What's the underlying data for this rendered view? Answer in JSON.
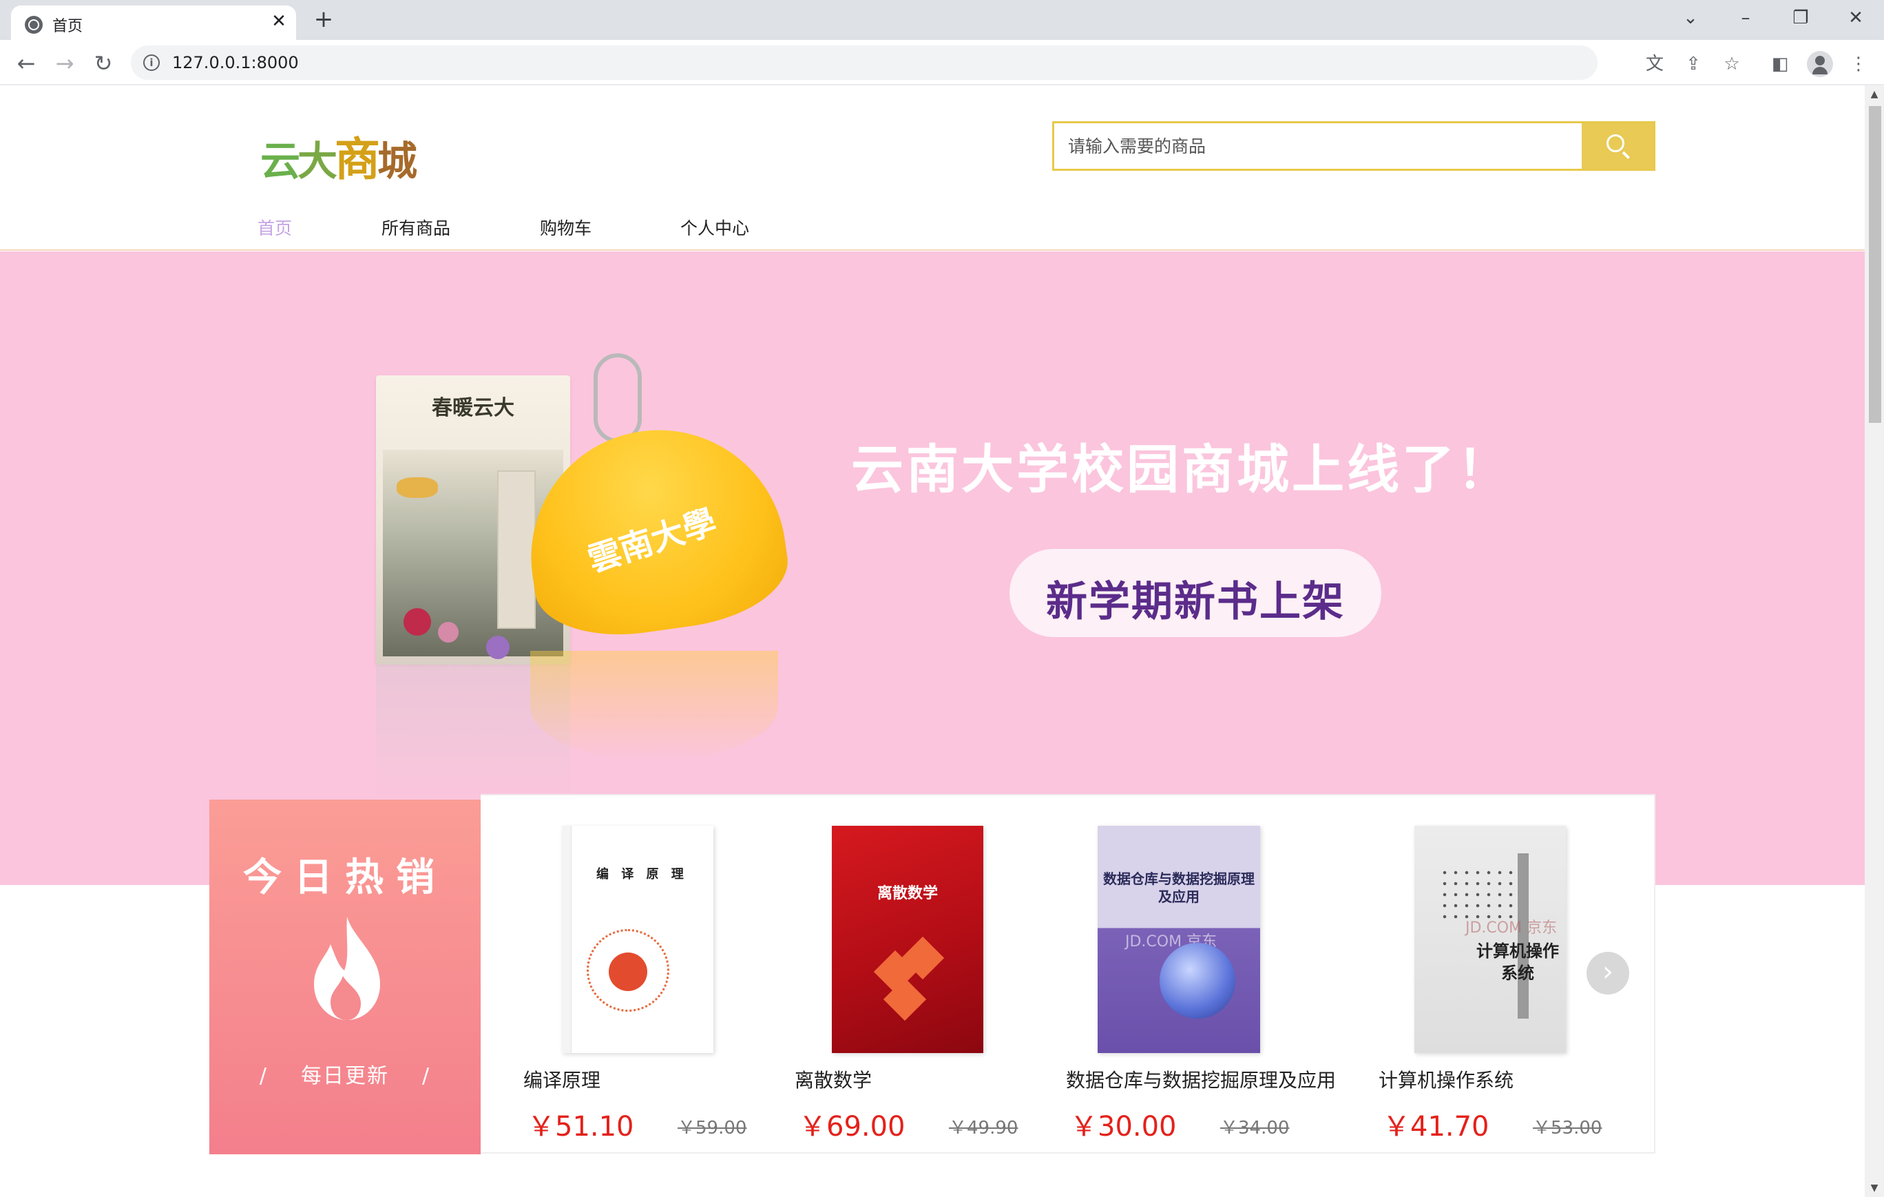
{
  "browser": {
    "tab_title": "首页",
    "url": "127.0.0.1:8000"
  },
  "site": {
    "logo_chars": [
      "云",
      "大",
      "商",
      "城"
    ],
    "search_placeholder": "请输入需要的商品",
    "nav": [
      {
        "label": "首页",
        "active": true
      },
      {
        "label": "所有商品",
        "active": false
      },
      {
        "label": "购物车",
        "active": false
      },
      {
        "label": "个人中心",
        "active": false
      }
    ]
  },
  "banner": {
    "headline": "云南大学校园商城上线了！",
    "pill": "新学期新书上架",
    "box_title": "春暖云大",
    "keychain_text": "雲南大學",
    "background": "#fbc5dd"
  },
  "hot": {
    "title": "今日热销",
    "subtitle": "每日更新",
    "slash": "/"
  },
  "products": [
    {
      "name": "编译原理",
      "price": "￥51.10",
      "old_price": "￥59.00",
      "cover_title": "编 译 原 理"
    },
    {
      "name": "离散数学",
      "price": "￥69.00",
      "old_price": "￥49.90",
      "cover_title": "离散数学"
    },
    {
      "name": "数据仓库与数据挖掘原理及应用",
      "price": "￥30.00",
      "old_price": "￥34.00",
      "cover_title": "数据仓库与数据挖掘原理及应用",
      "cover_watermark": "JD.COM 京东"
    },
    {
      "name": "计算机操作系统",
      "price": "￥41.70",
      "old_price": "￥53.00",
      "cover_title": "计算机操作系统",
      "cover_watermark": "JD.COM 京东"
    }
  ],
  "colors": {
    "accent": "#e8ca55",
    "price": "#e4211b",
    "nav_active": "#c5a3e6"
  }
}
